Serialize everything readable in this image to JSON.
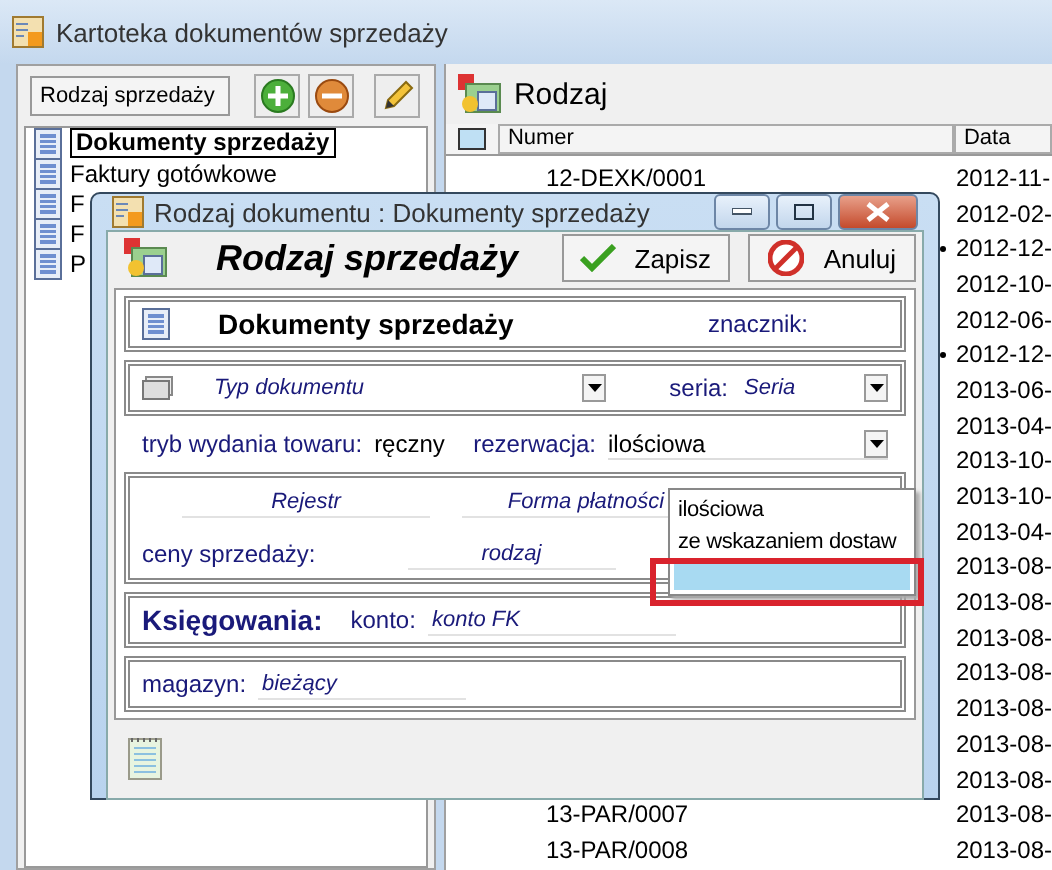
{
  "main_window": {
    "title": "Kartoteka dokumentów sprzedaży"
  },
  "left_panel": {
    "filter_label": "Rodzaj sprzedaży",
    "tree": [
      {
        "label": "Dokumenty sprzedaży",
        "selected": true
      },
      {
        "label": "Faktury gotówkowe",
        "selected": false
      },
      {
        "label": "F",
        "selected": false
      },
      {
        "label": "F",
        "selected": false
      },
      {
        "label": "P",
        "selected": false
      }
    ]
  },
  "right_panel": {
    "title": "Rodzaj",
    "columns": [
      "Numer",
      "Data"
    ],
    "rows": [
      {
        "numer": "12-DEXK/0001",
        "data": "2012-11-",
        "marked": false
      },
      {
        "data": "2012-02-",
        "marked": false
      },
      {
        "data": "2012-12-",
        "marked": true
      },
      {
        "data": "2012-10-",
        "marked": false
      },
      {
        "data": "2012-06-",
        "marked": false
      },
      {
        "data": "2012-12-",
        "marked": true
      },
      {
        "data": "2013-06-",
        "marked": false
      },
      {
        "data": "2013-04-",
        "marked": false
      },
      {
        "data": "2013-10-",
        "marked": false
      },
      {
        "data": "2013-10-",
        "marked": false
      },
      {
        "data": "2013-04-",
        "marked": false
      },
      {
        "data": "2013-08-",
        "marked": false
      },
      {
        "data": "2013-08-",
        "marked": false
      },
      {
        "data": "2013-08-",
        "marked": false
      },
      {
        "data": "2013-08-",
        "marked": false
      },
      {
        "data": "2013-08-",
        "marked": false
      },
      {
        "data": "2013-08-",
        "marked": false
      },
      {
        "data": "2013-08-",
        "marked": false
      },
      {
        "numer": "13-PAR/0007",
        "data": "2013-08-",
        "marked": false
      },
      {
        "numer": "13-PAR/0008",
        "data": "2013-08-",
        "marked": false
      }
    ]
  },
  "dialog": {
    "title": "Rodzaj dokumentu : Dokumenty sprzedaży",
    "heading": "Rodzaj sprzedaży",
    "buttons": [
      {
        "label": "Zapisz",
        "kind": "save"
      },
      {
        "label": "Anuluj",
        "kind": "cancel"
      }
    ],
    "document_name": "Dokumenty sprzedaży",
    "marker_label": "znacznik:",
    "document_type": {
      "placeholder": "Typ dokumentu"
    },
    "series_label": "seria:",
    "series": {
      "placeholder": "Seria"
    },
    "issue_mode_label": "tryb wydania towaru:",
    "issue_mode": "ręczny",
    "reservation_label": "rezerwacja:",
    "reservation": "ilościowa",
    "reservation_options": [
      {
        "label": "ilościowa",
        "selected": false
      },
      {
        "label": "ze wskazaniem dostaw",
        "selected": false
      },
      {
        "selected": true
      }
    ],
    "register": {
      "placeholder": "Rejestr"
    },
    "payment_form": {
      "placeholder": "Forma płatności"
    },
    "prices_label": "ceny sprzedaży:",
    "prices": {
      "placeholder": "rodzaj"
    },
    "accounting_label": "Księgowania:",
    "account_label": "konto:",
    "account": {
      "placeholder": "konto FK"
    },
    "warehouse_label": "magazyn:",
    "warehouse": {
      "placeholder": "bieżący"
    }
  },
  "highlight_annotation": true
}
